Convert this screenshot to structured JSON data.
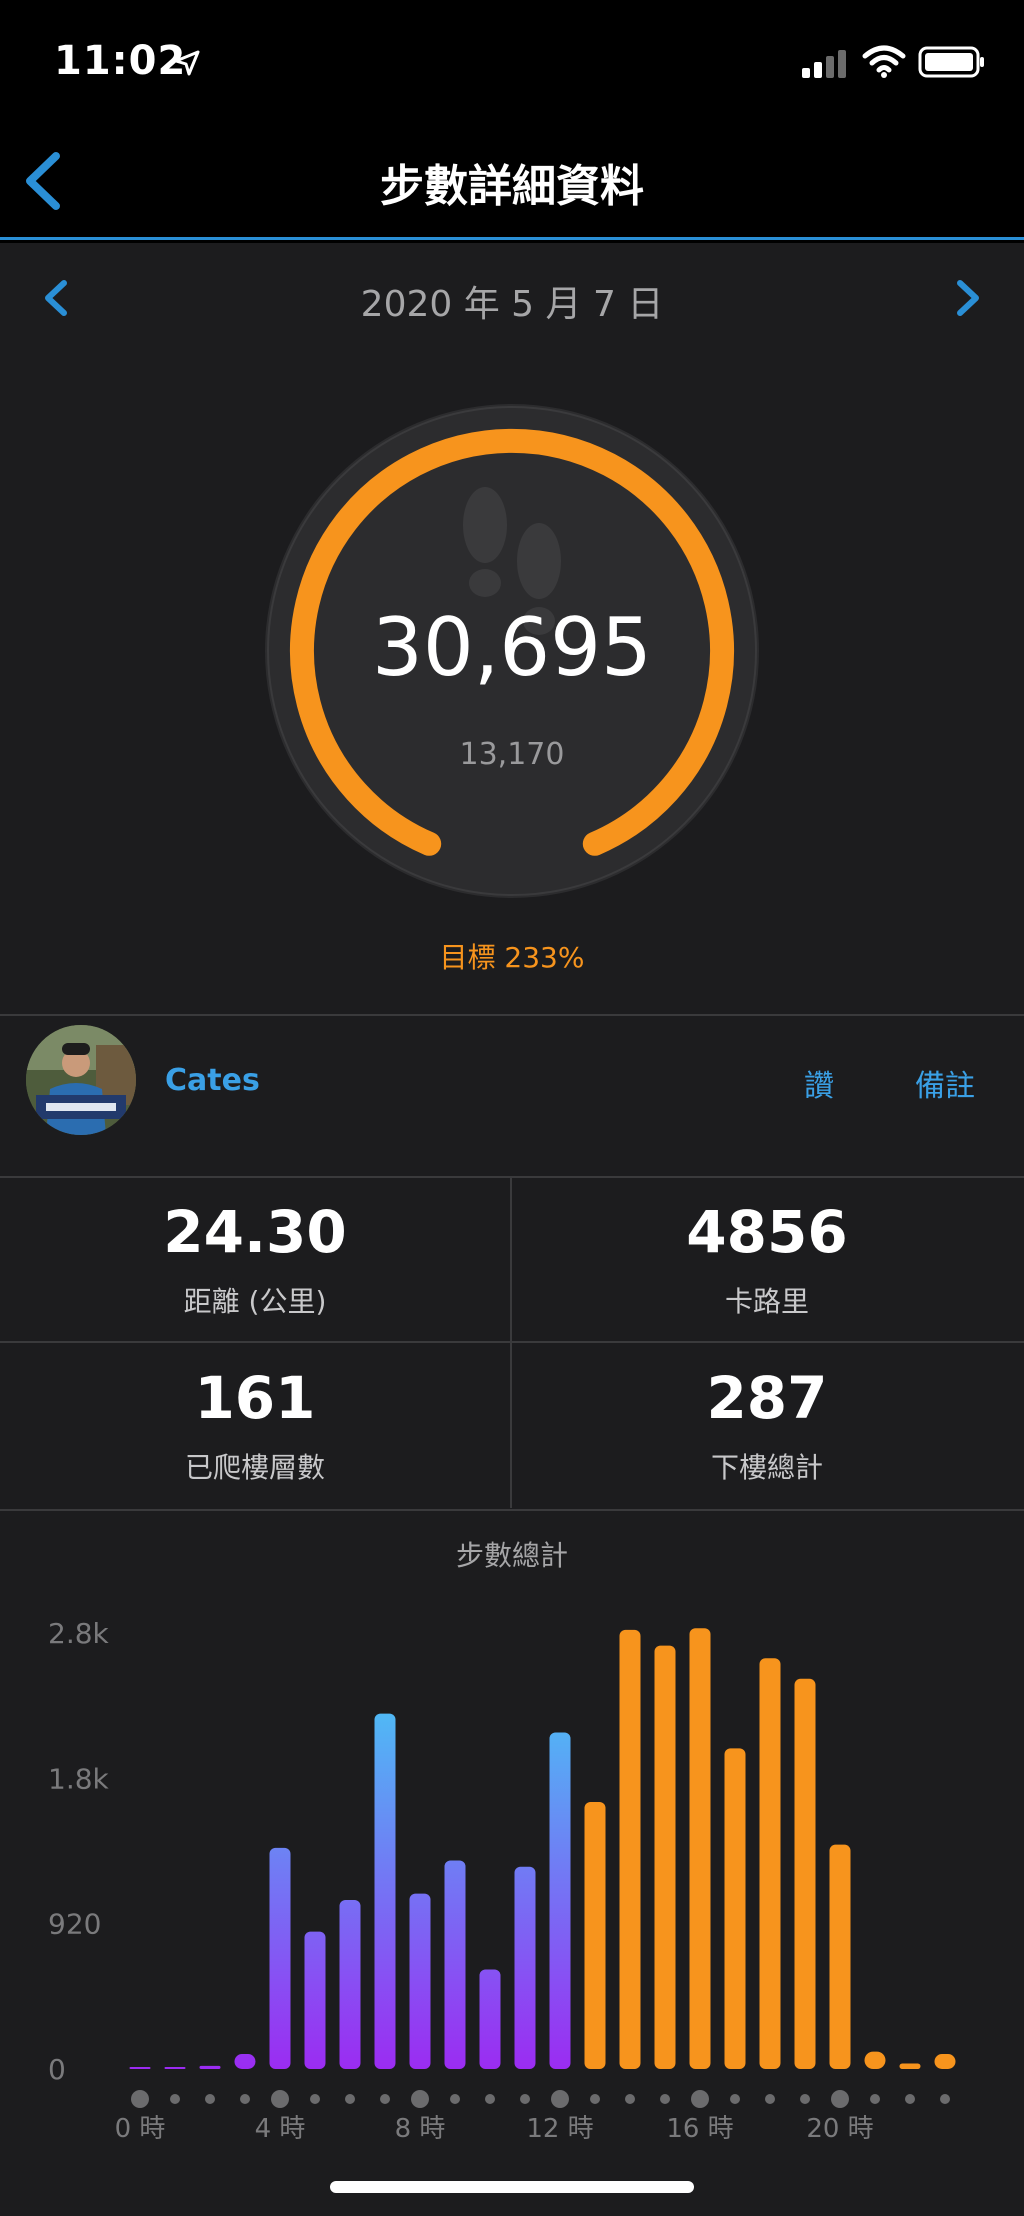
{
  "status_bar": {
    "time": "11:02",
    "icons": [
      "location-arrow-icon",
      "cellular-signal-icon",
      "wifi-icon",
      "battery-icon"
    ]
  },
  "nav": {
    "title": "步數詳細資料",
    "back_icon": "chevron-left-icon"
  },
  "date_nav": {
    "date": "2020 年 5 月 7 日",
    "prev_icon": "chevron-left-icon",
    "next_icon": "chevron-right-icon"
  },
  "ring": {
    "steps": "30,695",
    "goal": "13,170",
    "progress_fraction": 1.0,
    "icon": "footprints-icon",
    "goal_percent": "目標 233%"
  },
  "user": {
    "name": "Cates",
    "like_label": "讚",
    "notes_label": "備註"
  },
  "stats": [
    {
      "value": "24.30",
      "label": "距離 (公里)"
    },
    {
      "value": "4856",
      "label": "卡路里"
    },
    {
      "value": "161",
      "label": "已爬樓層數"
    },
    {
      "value": "287",
      "label": "下樓總計"
    }
  ],
  "colors": {
    "accent": "#f7941d",
    "link": "#3aa0e6",
    "nav_underline": "#2a8fd6",
    "bar_gradient_top": "#3fd8f6",
    "bar_gradient_bottom": "#9b2cf2",
    "bar_orange": "#f7941d"
  },
  "chart_data": {
    "type": "bar",
    "title": "步數總計",
    "categories": [
      "0",
      "1",
      "2",
      "3",
      "4",
      "5",
      "6",
      "7",
      "8",
      "9",
      "10",
      "11",
      "12",
      "13",
      "14",
      "15",
      "16",
      "17",
      "18",
      "19",
      "20",
      "21",
      "22",
      "23"
    ],
    "values": [
      10,
      10,
      20,
      95,
      1400,
      870,
      1070,
      2250,
      1110,
      1320,
      630,
      1280,
      2130,
      1690,
      2780,
      2680,
      2790,
      2030,
      2600,
      2470,
      1420,
      110,
      35,
      95
    ],
    "series_colors": [
      "gradient",
      "gradient",
      "gradient",
      "gradient",
      "gradient",
      "gradient",
      "gradient",
      "gradient",
      "gradient",
      "gradient",
      "gradient",
      "gradient",
      "gradient",
      "orange",
      "orange",
      "orange",
      "orange",
      "orange",
      "orange",
      "orange",
      "orange",
      "orange",
      "orange",
      "orange"
    ],
    "ylim": [
      0,
      2760
    ],
    "y_ticks": [
      {
        "value": 0,
        "label": "0"
      },
      {
        "value": 920,
        "label": "920"
      },
      {
        "value": 1840,
        "label": "1.8k"
      },
      {
        "value": 2760,
        "label": "2.8k"
      }
    ],
    "x_ticks": [
      {
        "index": 0,
        "label": "0 時"
      },
      {
        "index": 4,
        "label": "4 時"
      },
      {
        "index": 8,
        "label": "8 時"
      },
      {
        "index": 12,
        "label": "12 時"
      },
      {
        "index": 16,
        "label": "16 時"
      },
      {
        "index": 20,
        "label": "20 時"
      }
    ],
    "grid": false,
    "legend": "none"
  }
}
